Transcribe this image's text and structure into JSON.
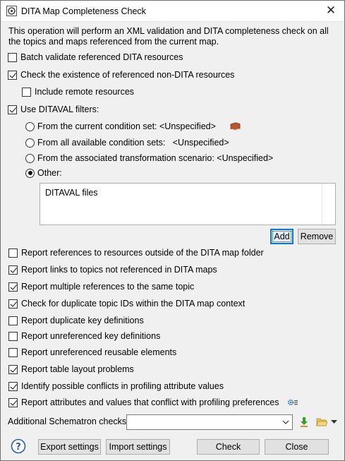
{
  "window": {
    "title": "DITA Map Completeness Check",
    "close_glyph": "✕"
  },
  "description": "This operation will perform an XML validation and DITA completeness check on all the topics and maps referenced from the current map.",
  "options": {
    "batch_validate": {
      "label": "Batch validate referenced DITA resources",
      "checked": false
    },
    "check_non_dita": {
      "label": "Check the existence of referenced non-DITA resources",
      "checked": true
    },
    "include_remote": {
      "label": "Include remote resources",
      "checked": false
    },
    "use_ditaval": {
      "label": "Use DITAVAL filters:",
      "checked": true
    }
  },
  "ditaval": {
    "radios": [
      {
        "label": "From the current condition set: <Unspecified>",
        "checked": false,
        "icon": "book-icon"
      },
      {
        "label": "From all available condition sets:   <Unspecified>",
        "checked": false
      },
      {
        "label": "From the associated transformation scenario: <Unspecified>",
        "checked": false
      },
      {
        "label": "Other:",
        "checked": true
      }
    ],
    "files_header": "DITAVAL files",
    "add_label": "Add",
    "remove_label": "Remove"
  },
  "report_options": [
    {
      "label": "Report references to resources outside of the DITA map folder",
      "checked": false
    },
    {
      "label": "Report links to topics not referenced in DITA maps",
      "checked": true
    },
    {
      "label": "Report multiple references to the same topic",
      "checked": true
    },
    {
      "label": "Check for duplicate topic IDs within the DITA map context",
      "checked": true
    },
    {
      "label": "Report duplicate key definitions",
      "checked": false
    },
    {
      "label": "Report unreferenced key definitions",
      "checked": false
    },
    {
      "label": "Report unreferenced reusable elements",
      "checked": false
    },
    {
      "label": "Report table layout problems",
      "checked": true
    },
    {
      "label": "Identify possible conflicts in profiling attribute values",
      "checked": true
    },
    {
      "label": "Report attributes and values that conflict with profiling preferences",
      "checked": true,
      "icon": "settings-icon"
    }
  ],
  "schematron": {
    "label": "Additional Schematron checks:",
    "value": "",
    "icons": [
      "download-icon",
      "folder-open-icon",
      "dropdown-icon"
    ]
  },
  "footer": {
    "help_icon": "help-icon",
    "export_label": "Export settings",
    "import_label": "Import settings",
    "check_label": "Check",
    "close_label": "Close"
  },
  "colors": {
    "dialog_bg": "#f0f0f0",
    "default_button_border": "#0078d7"
  }
}
